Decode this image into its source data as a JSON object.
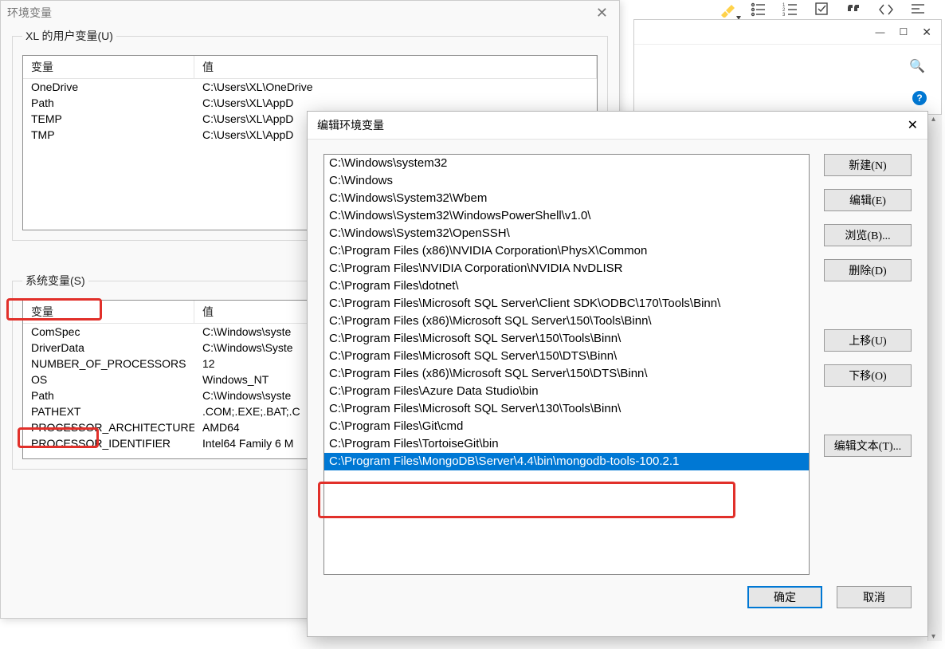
{
  "editor_icons": [
    "highlight-icon",
    "list-bullet-icon",
    "list-number-icon",
    "checkbox-icon",
    "quote-icon",
    "code-icon",
    "align-icon"
  ],
  "bg_window": {
    "minimize": "—",
    "maximize": "☐",
    "close": "✕",
    "search_icon": "🔍",
    "help": "?"
  },
  "env_dialog": {
    "title": "环境变量",
    "close": "✕",
    "user_section_label": "XL 的用户变量(U)",
    "system_section_label": "系统变量(S)",
    "col_var": "变量",
    "col_val": "值",
    "user_vars": [
      {
        "name": "OneDrive",
        "value": "C:\\Users\\XL\\OneDrive"
      },
      {
        "name": "Path",
        "value": "C:\\Users\\XL\\AppD"
      },
      {
        "name": "TEMP",
        "value": "C:\\Users\\XL\\AppD"
      },
      {
        "name": "TMP",
        "value": "C:\\Users\\XL\\AppD"
      }
    ],
    "system_vars": [
      {
        "name": "ComSpec",
        "value": "C:\\Windows\\syste"
      },
      {
        "name": "DriverData",
        "value": "C:\\Windows\\Syste"
      },
      {
        "name": "NUMBER_OF_PROCESSORS",
        "value": "12"
      },
      {
        "name": "OS",
        "value": "Windows_NT"
      },
      {
        "name": "Path",
        "value": "C:\\Windows\\syste"
      },
      {
        "name": "PATHEXT",
        "value": ".COM;.EXE;.BAT;.C"
      },
      {
        "name": "PROCESSOR_ARCHITECTURE",
        "value": "AMD64"
      },
      {
        "name": "PROCESSOR_IDENTIFIER",
        "value": "Intel64 Family 6 M"
      }
    ]
  },
  "edit_dialog": {
    "title": "编辑环境变量",
    "close": "✕",
    "paths": [
      "C:\\Windows\\system32",
      "C:\\Windows",
      "C:\\Windows\\System32\\Wbem",
      "C:\\Windows\\System32\\WindowsPowerShell\\v1.0\\",
      "C:\\Windows\\System32\\OpenSSH\\",
      "C:\\Program Files (x86)\\NVIDIA Corporation\\PhysX\\Common",
      "C:\\Program Files\\NVIDIA Corporation\\NVIDIA NvDLISR",
      "C:\\Program Files\\dotnet\\",
      "C:\\Program Files\\Microsoft SQL Server\\Client SDK\\ODBC\\170\\Tools\\Binn\\",
      "C:\\Program Files (x86)\\Microsoft SQL Server\\150\\Tools\\Binn\\",
      "C:\\Program Files\\Microsoft SQL Server\\150\\Tools\\Binn\\",
      "C:\\Program Files\\Microsoft SQL Server\\150\\DTS\\Binn\\",
      "C:\\Program Files (x86)\\Microsoft SQL Server\\150\\DTS\\Binn\\",
      "C:\\Program Files\\Azure Data Studio\\bin",
      "C:\\Program Files\\Microsoft SQL Server\\130\\Tools\\Binn\\",
      "C:\\Program Files\\Git\\cmd",
      "C:\\Program Files\\TortoiseGit\\bin",
      "C:\\Program Files\\MongoDB\\Server\\4.4\\bin\\mongodb-tools-100.2.1"
    ],
    "selected_index": 17,
    "buttons": {
      "new": "新建(N)",
      "edit": "编辑(E)",
      "browse": "浏览(B)...",
      "delete": "删除(D)",
      "up": "上移(U)",
      "down": "下移(O)",
      "edit_text": "编辑文本(T)...",
      "ok": "确定",
      "cancel": "取消"
    }
  }
}
